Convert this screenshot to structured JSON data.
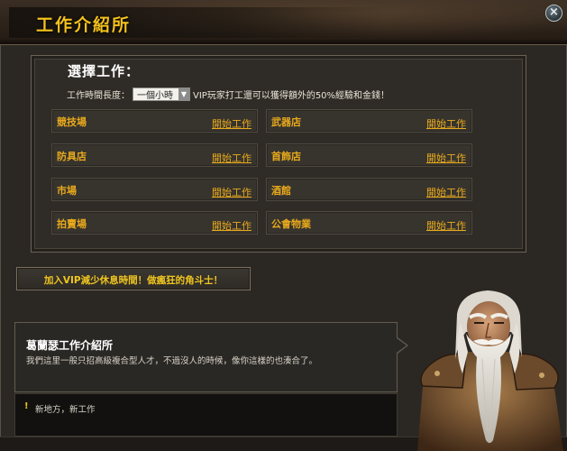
{
  "window": {
    "title": "工作介紹所",
    "close_label": "×"
  },
  "jobs_panel": {
    "heading": "選擇工作：",
    "duration_label": "工作時間長度：",
    "duration_selected": "一個小時",
    "vip_note": "VIP玩家打工還可以獲得額外的50%經驗和金錢！",
    "jobs": [
      {
        "name": "競技場",
        "action": "開始工作"
      },
      {
        "name": "武器店",
        "action": "開始工作"
      },
      {
        "name": "防具店",
        "action": "開始工作"
      },
      {
        "name": "首飾店",
        "action": "開始工作"
      },
      {
        "name": "市場",
        "action": "開始工作"
      },
      {
        "name": "酒館",
        "action": "開始工作"
      },
      {
        "name": "拍賣場",
        "action": "開始工作"
      },
      {
        "name": "公會物業",
        "action": "開始工作"
      }
    ]
  },
  "vip_banner": {
    "text": "加入VIP減少休息時間！做瘋狂的角斗士！"
  },
  "dialogue": {
    "npc_name": "葛蘭瑟工作介紹所",
    "line": "我們這里一般只招高級複合型人才，不過沒人的時候，像你這樣的也湊合了。"
  },
  "notice": {
    "icon": "!",
    "text": "新地方，新工作"
  },
  "colors": {
    "accent_gold": "#f4c21c",
    "job_text": "#e8a91c",
    "panel_bg": "#2f2c27"
  },
  "icons": {
    "close": "close-icon",
    "dropdown": "chevron-down-icon",
    "notice": "exclamation-icon"
  }
}
